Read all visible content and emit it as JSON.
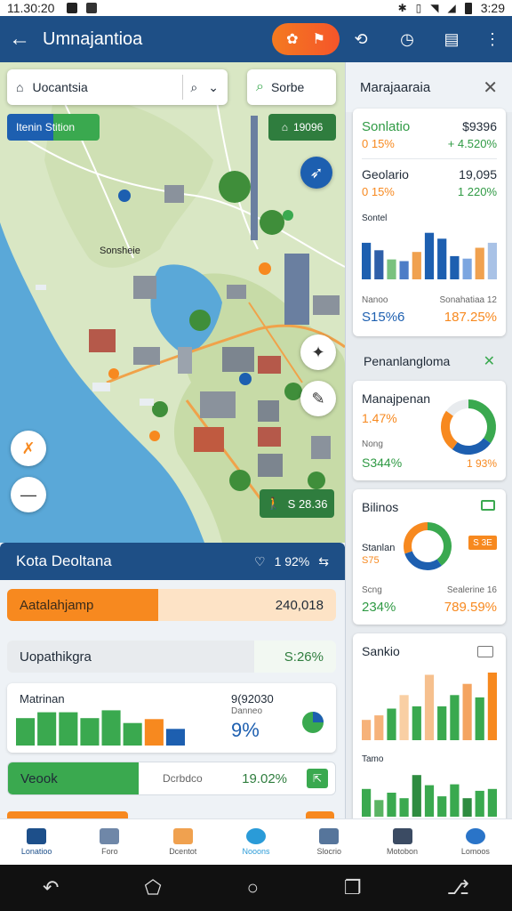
{
  "status_bar": {
    "time_left": "11.30:20",
    "time_right": "3:29"
  },
  "app_bar": {
    "title": "Umnajantioa"
  },
  "map": {
    "search_text": "Uocantsia",
    "search2_text": "Sorbe",
    "chip_left": "Itenin  Stition",
    "chip_right": "19096",
    "place_label": "Sonsheie",
    "badge_text": "S 28.36"
  },
  "list": {
    "header_title": "Kota Deoltana",
    "header_value": "1 92%",
    "rows": [
      {
        "label": "Aatalahjamp",
        "value": "240,018",
        "color": "#f7891f",
        "bg": "#fde3c6",
        "fill": 0.46
      },
      {
        "label": "Uopathikgra",
        "value": "S:26%",
        "color": "#e8ebee",
        "bg": "#f2f8f2",
        "fill": 0.75
      },
      {
        "label": "Veook",
        "value": "19.02%",
        "color": "#3aa94f",
        "bg": "#ffffff",
        "fill": 0.4,
        "sub": "Dcrbdco"
      }
    ],
    "mini_card": {
      "title": "Matrinan",
      "value_top": "9(92030",
      "sub": "Danneo",
      "value_big": "9%"
    }
  },
  "right_panel": {
    "title": "Marajaaraia",
    "card1": {
      "name1": "Sonlatio",
      "val1": "$9396",
      "pct1": "0 15%",
      "pct1b": "+ 4.520%",
      "name2": "Geolario",
      "val2": "19,095",
      "pct2": "0 15%",
      "pct2b": "1 220%",
      "chart_label": "Sontel",
      "foot_left_label": "Nanoo",
      "foot_left": "S15%6",
      "foot_right_label": "Sonahatiaa 12",
      "foot_right": "187.25%"
    },
    "card2_title": "Penanlangloma",
    "card2": {
      "name": "Manajpenan",
      "pct": "1.47%",
      "sub": "Nong",
      "val": "S344%",
      "right": "1 93%"
    },
    "card3": {
      "title": "Bilinos",
      "badge": "S 3E",
      "name": "Stanlan",
      "pct": "S75",
      "left_label": "Scng",
      "left_val": "234%",
      "right_label": "Sealerine 16",
      "right_val": "789.59%"
    },
    "card4": {
      "title": "Sankio",
      "sub": "Tamo"
    }
  },
  "chart_data": [
    {
      "type": "bar",
      "title": "Sontel",
      "series": [
        {
          "values": [
            44,
            35,
            24,
            22,
            33,
            56,
            49,
            28,
            25,
            38,
            44
          ]
        }
      ],
      "colors": [
        "#1d5fb0",
        "#2f5fa9",
        "#7ac27f",
        "#4d7dc7",
        "#f0a14f",
        "#1d5fb0",
        "#1d5fb0",
        "#1d5fb0",
        "#7ca6e0",
        "#f0a14f",
        "#a9c2e6"
      ],
      "ylim": [
        0,
        60
      ]
    },
    {
      "type": "bar",
      "title": "Matrinan",
      "series": [
        {
          "values": [
            28,
            34,
            34,
            28,
            36,
            23,
            27,
            17
          ]
        }
      ],
      "colors": [
        "#3aa94f",
        "#3aa94f",
        "#3aa94f",
        "#3aa94f",
        "#3aa94f",
        "#3aa94f",
        "#f7891f",
        "#1d5fb0"
      ],
      "ylim": [
        0,
        40
      ]
    },
    {
      "type": "bar",
      "title": "Sankio",
      "series": [
        {
          "values": [
            18,
            22,
            28,
            40,
            30,
            58,
            30,
            40,
            50,
            38,
            60
          ]
        }
      ],
      "colors": [
        "#f6b27a",
        "#f6b27a",
        "#3aa94f",
        "#f9cfa4",
        "#3aa94f",
        "#f6c08e",
        "#3aa94f",
        "#3aa94f",
        "#f4a460",
        "#3aa94f",
        "#f7891f"
      ],
      "ylim": [
        0,
        60
      ]
    },
    {
      "type": "bar",
      "title": "Tamo",
      "series": [
        {
          "values": [
            30,
            18,
            26,
            20,
            45,
            34,
            22,
            35,
            20,
            28,
            30
          ]
        }
      ],
      "colors": [
        "#3aa94f",
        "#5ab463",
        "#3aa94f",
        "#3aa94f",
        "#2e8c40",
        "#3aa94f",
        "#3aa94f",
        "#3aa94f",
        "#2e8c40",
        "#3aa94f",
        "#3aa94f"
      ],
      "ylim": [
        0,
        50
      ]
    },
    {
      "type": "pie",
      "title": "Manajpenan",
      "values": [
        35,
        25,
        25,
        15
      ],
      "colors": [
        "#3aa94f",
        "#1d5fb0",
        "#f7891f",
        "#e8ebee"
      ]
    },
    {
      "type": "pie",
      "title": "Bilinos",
      "values": [
        40,
        30,
        30
      ],
      "colors": [
        "#3aa94f",
        "#1d5fb0",
        "#f7891f"
      ]
    }
  ],
  "bottom_nav": [
    {
      "label": "Lonatioo",
      "icon": "home-icon",
      "color": "#1d4f8a"
    },
    {
      "label": "Foro",
      "icon": "map-icon",
      "color": "#6f87a8"
    },
    {
      "label": "Dcentot",
      "icon": "book-icon",
      "color": "#f0a14f"
    },
    {
      "label": "Nooons",
      "icon": "location-icon",
      "color": "#2a9bd8"
    },
    {
      "label": "Slocrio",
      "icon": "edit-icon",
      "color": "#56759b"
    },
    {
      "label": "Motobon",
      "icon": "tools-icon",
      "color": "#3b4b63"
    },
    {
      "label": "Lomoos",
      "icon": "run-icon",
      "color": "#2a74c8"
    }
  ]
}
